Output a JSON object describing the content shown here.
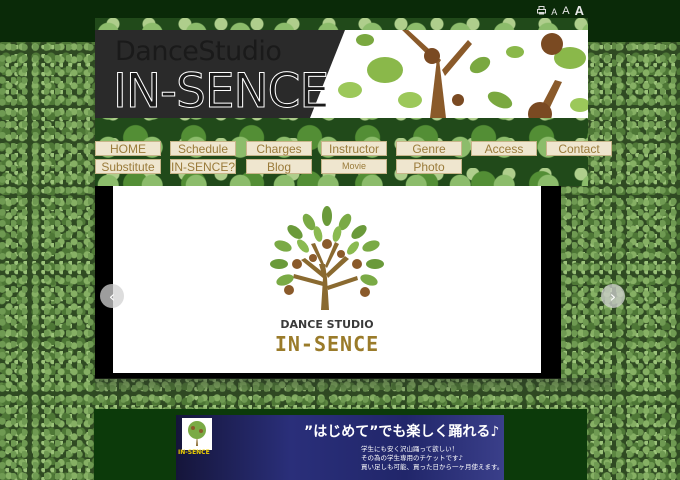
{
  "toolbar": {
    "print_icon": "print-icon",
    "size_small": "A",
    "size_medium": "A",
    "size_large": "A"
  },
  "header": {
    "logo_line1": "DanceStudio",
    "logo_line2": "IN-SENCE"
  },
  "nav": {
    "row1": [
      "HOME",
      "Schedule",
      "Charges",
      "Instructor",
      "Genre",
      "Access",
      "Contact"
    ],
    "row2": [
      "Substitute",
      "IN-SENCE?",
      "Blog",
      "Movie",
      "Photo"
    ]
  },
  "slider": {
    "logo_line1": "DANCE STUDIO",
    "logo_line2": "IN-SENCE",
    "prev_icon": "chevron-left-icon",
    "next_icon": "chevron-right-icon"
  },
  "banner": {
    "logo_text": "IN-SENCE",
    "title": "”はじめて”でも楽しく踊れる♪",
    "lines": [
      "学生にも安く沢山踊って欲しい！",
      "その為の学生専用のチケットです♪",
      "買い足しも可能、買った日から一ヶ月使えます。"
    ]
  },
  "colors": {
    "nav_bg": "#efe6cf",
    "nav_text": "#9a7b3a",
    "dark_green": "#0a2a08",
    "logo_brown": "#8a6a30",
    "logo_green": "#6a9a3a"
  }
}
